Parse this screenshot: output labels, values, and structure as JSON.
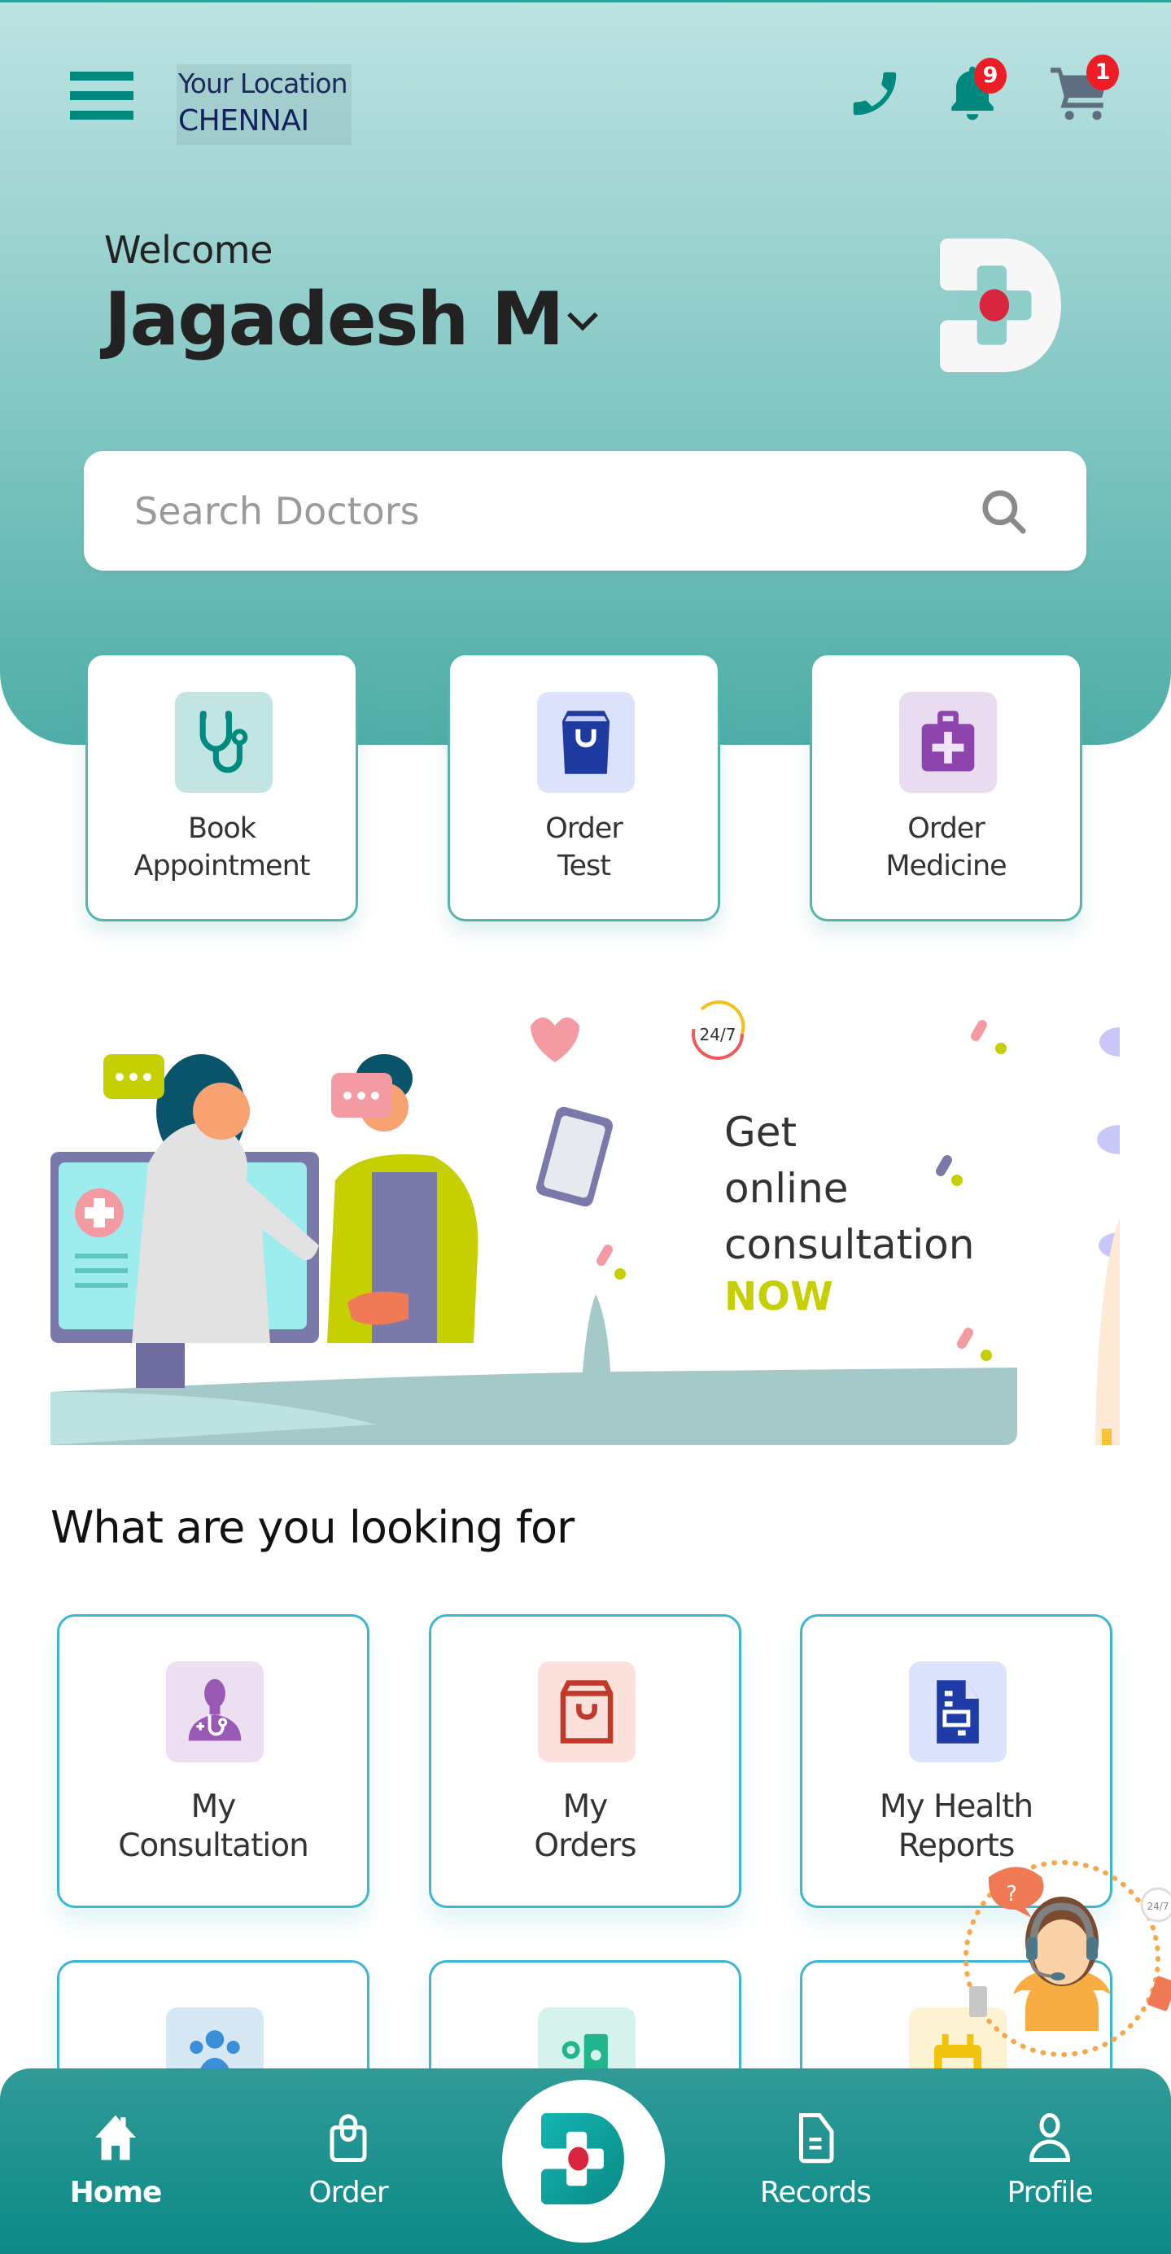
{
  "header": {
    "location_label": "Your Location",
    "location_value": "CHENNAI",
    "notifications_count": "9",
    "cart_count": "1",
    "welcome": "Welcome",
    "user_name": "Jagadesh M",
    "icons": {
      "menu": "hamburger-menu-icon",
      "phone": "phone-icon",
      "bell": "bell-icon",
      "cart": "cart-icon",
      "logo": "app-logo-d-cross",
      "chevron": "chevron-down-icon"
    }
  },
  "search": {
    "placeholder": "Search Doctors",
    "value": "",
    "icon": "search-icon"
  },
  "quick_actions": [
    {
      "line1": "Book",
      "line2": "Appointment",
      "icon": "stethoscope-icon",
      "icon_color": "#00897f",
      "bg": "#c2e5e4"
    },
    {
      "line1": "Order",
      "line2": "Test",
      "icon": "shopping-bag-icon",
      "icon_color": "#1e3aa0",
      "bg": "#dde2fc"
    },
    {
      "line1": "Order",
      "line2": "Medicine",
      "icon": "medical-kit-icon",
      "icon_color": "#8e44ad",
      "bg": "#e9dcf0"
    }
  ],
  "banner": {
    "badge": "24/7",
    "line1": "Get",
    "line2": "online",
    "line3": "consultation",
    "highlight": "NOW"
  },
  "section": {
    "title": "What are you looking for"
  },
  "grid_items": [
    {
      "line1": "My",
      "line2": "Consultation",
      "icon": "doctor-icon",
      "icon_color": "#9b59b6",
      "bg": "#ebdff1"
    },
    {
      "line1": "My",
      "line2": "Orders",
      "icon": "bag-icon",
      "icon_color": "#c0392b",
      "bg": "#fbe0dc"
    },
    {
      "line1": "My Health",
      "line2": "Reports",
      "icon": "report-document-icon",
      "icon_color": "#1f3ca6",
      "bg": "#dde3fc"
    },
    {
      "line1": "",
      "line2": "",
      "icon": "family-group-icon",
      "icon_color": "#3a8fd8",
      "bg": "#d6e8f4"
    },
    {
      "line1": "",
      "line2": "",
      "icon": "id-card-icon",
      "icon_color": "#1fb58f",
      "bg": "#d5f3ec"
    },
    {
      "line1": "",
      "line2": "",
      "icon": "calendar-icon",
      "icon_color": "#f0c30f",
      "bg": "#fdf3d3"
    }
  ],
  "support_widget": {
    "badge": "24/7",
    "question_mark": "?",
    "icon": "customer-support-agent-icon"
  },
  "bottom_nav": {
    "items": [
      {
        "label": "Home",
        "icon": "home-icon",
        "active": true
      },
      {
        "label": "Order",
        "icon": "shopping-bag-outline-icon",
        "active": false
      },
      {
        "label": "Records",
        "icon": "document-outline-icon",
        "active": false
      },
      {
        "label": "Profile",
        "icon": "user-outline-icon",
        "active": false
      }
    ],
    "center_icon": "app-logo-d-cross"
  },
  "colors": {
    "primary_teal": "#00897f",
    "header_gradient_top": "#bde3e3",
    "header_gradient_bottom": "#4fada7",
    "badge_red": "#ee1c25",
    "card_border_quick": "#55b4ab",
    "card_border_grid": "#3db6d2",
    "nav_bg": "#0b8a86",
    "logo_red": "#d7263d",
    "now_highlight": "#c6d000"
  }
}
